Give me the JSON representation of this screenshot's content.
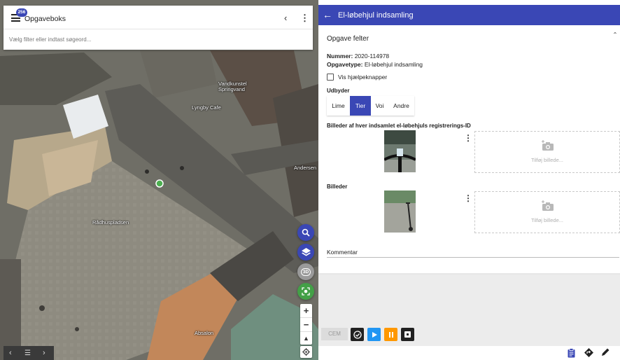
{
  "map": {
    "panel": {
      "title": "Opgaveboks",
      "badge": "256",
      "search_placeholder": "Vælg filter eller indtast søgeord..."
    },
    "labels": [
      {
        "text": "Rådhuspladsen"
      },
      {
        "text": "Vandkunstel\nSpringvand"
      },
      {
        "text": "Lyngby Cafe"
      },
      {
        "text": "Absalon"
      },
      {
        "text": "Andersen"
      }
    ],
    "controls": {
      "layer_3d": "3D",
      "zoom_in": "+",
      "zoom_out": "−"
    },
    "marker_color": "#4caf50"
  },
  "form": {
    "title": "El-løbehjul indsamling",
    "section": "Opgave felter",
    "number_label": "Nummer:",
    "number_value": "2020-114978",
    "type_label": "Opgavetype:",
    "type_value": "El-løbehjul indsamling",
    "help_toggle": "Vis hjælpeknapper",
    "provider_label": "Udbyder",
    "providers": [
      "Lime",
      "Tier",
      "Voi",
      "Andre"
    ],
    "selected_provider": "Tier",
    "image_id_label": "Billeder af hver indsamlet el-løbehjuls registrerings-ID",
    "images_label": "Billeder",
    "add_image": "Tilføj billede...",
    "comment_label": "Kommentar",
    "actions": {
      "cem": "CEM"
    }
  },
  "colors": {
    "primary": "#3a47b5",
    "play": "#2196f3",
    "pause": "#ff9800",
    "check": "#212121"
  }
}
